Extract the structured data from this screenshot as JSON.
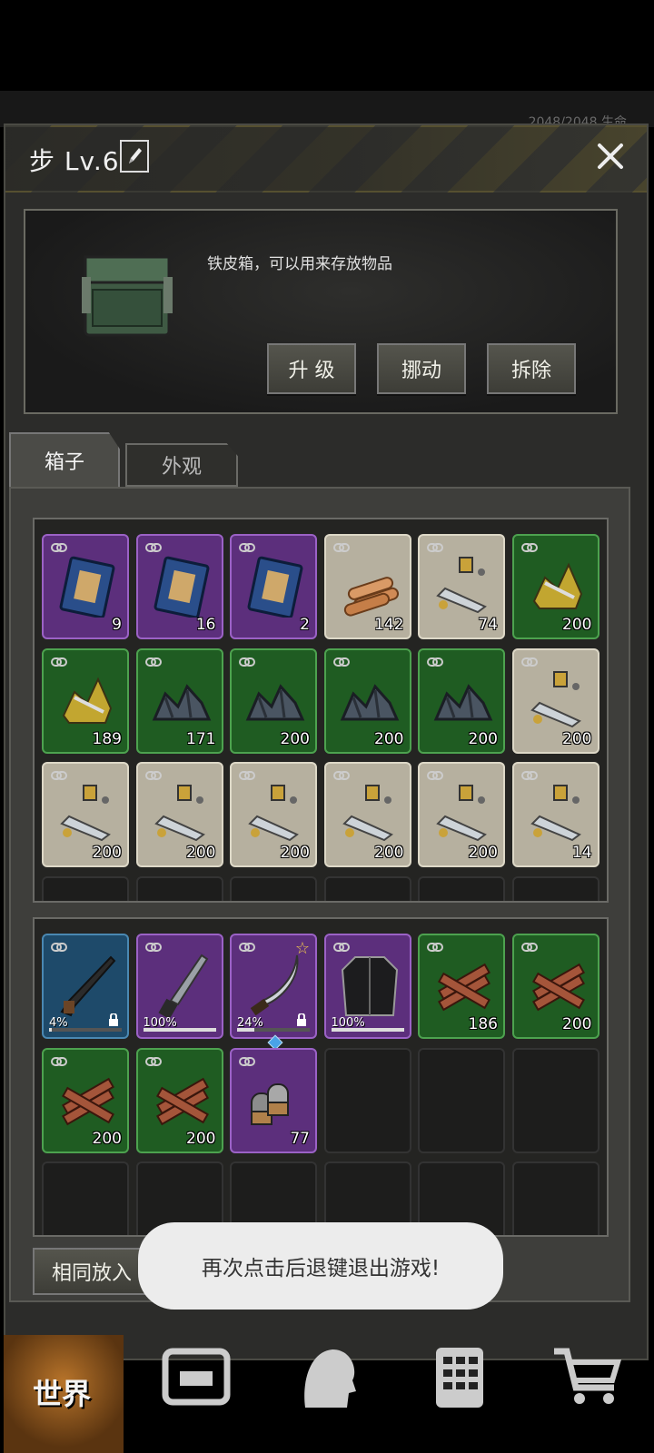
{
  "background": {
    "partial_status": "2048/2048    生命"
  },
  "panel": {
    "title": "步 Lv.6",
    "edit_icon": "pencil-icon",
    "close_icon": "close-icon"
  },
  "info": {
    "description": "铁皮箱，可以用来存放物品",
    "buttons": {
      "upgrade": "升 级",
      "move": "挪动",
      "dismantle": "拆除"
    }
  },
  "tabs": {
    "box": "箱子",
    "appearance": "外观"
  },
  "box_items": [
    {
      "kind": "book",
      "rarity": "purple",
      "count": "9"
    },
    {
      "kind": "book",
      "rarity": "purple",
      "count": "16"
    },
    {
      "kind": "book",
      "rarity": "purple",
      "count": "2"
    },
    {
      "kind": "logs",
      "rarity": "gray",
      "count": "142"
    },
    {
      "kind": "scrap",
      "rarity": "gray",
      "count": "74"
    },
    {
      "kind": "junk",
      "rarity": "green",
      "count": "200"
    },
    {
      "kind": "junk",
      "rarity": "green",
      "count": "189"
    },
    {
      "kind": "ore",
      "rarity": "green",
      "count": "171"
    },
    {
      "kind": "ore",
      "rarity": "green",
      "count": "200"
    },
    {
      "kind": "ore",
      "rarity": "green",
      "count": "200"
    },
    {
      "kind": "ore",
      "rarity": "green",
      "count": "200"
    },
    {
      "kind": "scrap",
      "rarity": "gray",
      "count": "200"
    },
    {
      "kind": "scrap",
      "rarity": "gray",
      "count": "200"
    },
    {
      "kind": "scrap",
      "rarity": "gray",
      "count": "200"
    },
    {
      "kind": "scrap",
      "rarity": "gray",
      "count": "200"
    },
    {
      "kind": "scrap",
      "rarity": "gray",
      "count": "200"
    },
    {
      "kind": "scrap",
      "rarity": "gray",
      "count": "200"
    },
    {
      "kind": "scrap",
      "rarity": "gray",
      "count": "14"
    }
  ],
  "bag_items": [
    {
      "kind": "rifle",
      "rarity": "blue",
      "percent": "4%",
      "durability": 0.04,
      "locked": true
    },
    {
      "kind": "knife",
      "rarity": "purple",
      "percent": "100%",
      "durability": 1.0
    },
    {
      "kind": "sword",
      "rarity": "purple",
      "percent": "24%",
      "durability": 0.24,
      "locked": true,
      "starred": true
    },
    {
      "kind": "coat",
      "rarity": "purple",
      "percent": "100%",
      "durability": 1.0
    },
    {
      "kind": "wood",
      "rarity": "green",
      "count": "186"
    },
    {
      "kind": "wood",
      "rarity": "green",
      "count": "200"
    },
    {
      "kind": "wood",
      "rarity": "green",
      "count": "200"
    },
    {
      "kind": "wood",
      "rarity": "green",
      "count": "200"
    },
    {
      "kind": "ammo",
      "rarity": "purple",
      "count": "77"
    }
  ],
  "controls": {
    "same_put": "相同放入"
  },
  "toast": "再次点击后退键退出游戏!",
  "nav": {
    "world": "世界"
  },
  "colors": {
    "purple": "#5c2f7c",
    "green": "#1f5c22",
    "gray": "#b6b09f",
    "blue": "#1e4a6a"
  }
}
